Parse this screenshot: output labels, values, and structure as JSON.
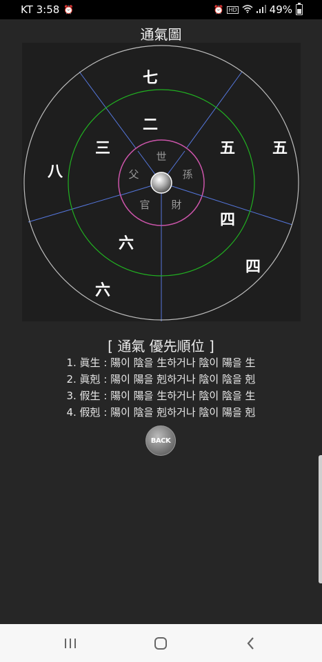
{
  "status_bar": {
    "carrier_time": "KT 3:58",
    "battery": "49%",
    "battery_level": 0.49,
    "icons": [
      "alarm-icon",
      "alarm-icon",
      "hd-icon",
      "wifi-icon",
      "signal-icon",
      "battery-icon"
    ]
  },
  "page": {
    "title": "通氣圖"
  },
  "chart": {
    "center_labels": [
      "世",
      "孫",
      "財",
      "官",
      "父"
    ],
    "middle_labels": [
      "二",
      "三",
      "五",
      "四",
      "六"
    ],
    "outer_labels": [
      "七",
      "八",
      "五",
      "四",
      "六"
    ],
    "colors": {
      "outer_circle": "#bdbdbd",
      "middle_circle": "#21b121",
      "inner_circle": "#cc55aa",
      "spokes": "#5577dd",
      "inner_text": "#9a9a9a",
      "numeral_text": "#ffffff"
    }
  },
  "priority": {
    "title": "[ 通氣 優先順位 ]",
    "rules": [
      "1. 眞生 : 陽이 陰을 生하거나 陰이 陽을 生",
      "2. 眞剋 : 陽이 陽을 剋하거나 陰이 陰을 剋",
      "3. 假生 : 陽이 陽을 生하거나 陰이 陰을 生",
      "4. 假剋 : 陽이 陰을 剋하거나 陰이 陽을 剋"
    ]
  },
  "back_button": {
    "label": "BACK"
  },
  "nav": {
    "icons": [
      "recent-apps-icon",
      "home-icon",
      "back-icon"
    ]
  }
}
